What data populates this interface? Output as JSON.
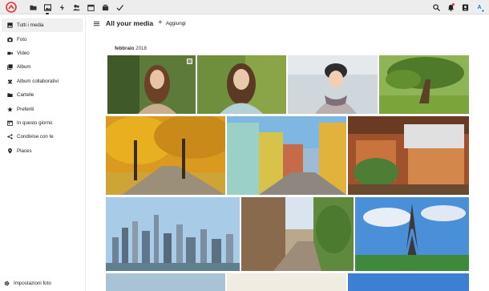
{
  "topbar": {
    "apps": [
      {
        "name": "files-icon"
      },
      {
        "name": "photos-icon"
      },
      {
        "name": "activity-icon"
      },
      {
        "name": "contacts-icon"
      },
      {
        "name": "calendar-icon"
      },
      {
        "name": "deck-icon"
      },
      {
        "name": "tasks-icon"
      }
    ],
    "avatar_initial": "A"
  },
  "sidebar": {
    "items": [
      {
        "label": "Tutti i media",
        "icon": "image-icon"
      },
      {
        "label": "Foto",
        "icon": "camera-icon"
      },
      {
        "label": "Video",
        "icon": "video-icon"
      },
      {
        "label": "Album",
        "icon": "album-icon"
      },
      {
        "label": "Album collaborativi",
        "icon": "shared-album-icon"
      },
      {
        "label": "Cartelle",
        "icon": "folder-icon"
      },
      {
        "label": "Preferiti",
        "icon": "star-icon"
      },
      {
        "label": "In questo giorno",
        "icon": "calendar-day-icon"
      },
      {
        "label": "Condivise con te",
        "icon": "share-icon"
      },
      {
        "label": "Places",
        "icon": "map-pin-icon"
      }
    ],
    "settings_label": "Impostazioni foto"
  },
  "header": {
    "title": "All your media",
    "add_label": "Aggiungi"
  },
  "gallery": {
    "month": "febbraio",
    "year": "2018"
  },
  "colors": {
    "accent": "#0082c9",
    "topbar": "#ededed",
    "logo": "#e9322d"
  }
}
